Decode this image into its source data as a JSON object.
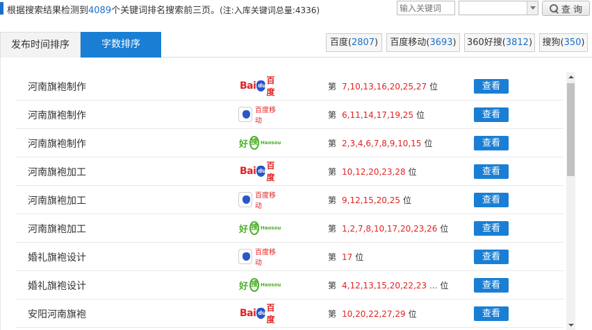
{
  "summary": {
    "prefix": "根据搜索结果检测到",
    "count": "4089",
    "suffix": "个关键词排名搜索前三页。",
    "note": "(注:入库关键词总量:4336)"
  },
  "search": {
    "placeholder": "输入关键词",
    "select_value": "",
    "button_label": "查 询"
  },
  "tabs": [
    {
      "label": "发布时间排序",
      "active": false
    },
    {
      "label": "字数排序",
      "active": true
    }
  ],
  "engines": [
    {
      "name": "百度",
      "count": "2807"
    },
    {
      "name": "百度移动",
      "count": "3693"
    },
    {
      "name": "360好搜",
      "count": "3812"
    },
    {
      "name": "搜狗",
      "count": "350"
    }
  ],
  "colors": {
    "accent": "#1a7fd4",
    "rank": "#e02222"
  },
  "rank_prefix": "第",
  "rank_suffix": "位",
  "view_label": "查看",
  "logo_text": {
    "baidu_bai": "Bai",
    "baidu_cn": "百度",
    "mobile_cn": "百度移动",
    "haosou_hao": "好",
    "haosou_sou": "搜",
    "haosou_en": "Haosou"
  },
  "rows": [
    {
      "keyword": "河南旗袍制作",
      "engine": "baidu",
      "positions": "7,10,13,16,20,25,27"
    },
    {
      "keyword": "河南旗袍制作",
      "engine": "baidu-mobile",
      "positions": "6,11,14,17,19,25"
    },
    {
      "keyword": "河南旗袍制作",
      "engine": "haosou",
      "positions": "2,3,4,6,7,8,9,10,15"
    },
    {
      "keyword": "河南旗袍加工",
      "engine": "baidu",
      "positions": "10,12,20,23,28"
    },
    {
      "keyword": "河南旗袍加工",
      "engine": "baidu-mobile",
      "positions": "9,12,15,20,25"
    },
    {
      "keyword": "河南旗袍加工",
      "engine": "haosou",
      "positions": "1,2,7,8,10,17,20,23,26"
    },
    {
      "keyword": "婚礼旗袍设计",
      "engine": "baidu-mobile",
      "positions": "17"
    },
    {
      "keyword": "婚礼旗袍设计",
      "engine": "haosou",
      "positions": "4,12,13,15,20,22,23 ..."
    },
    {
      "keyword": "安阳河南旗袍",
      "engine": "baidu",
      "positions": "10,20,22,27,29"
    }
  ]
}
